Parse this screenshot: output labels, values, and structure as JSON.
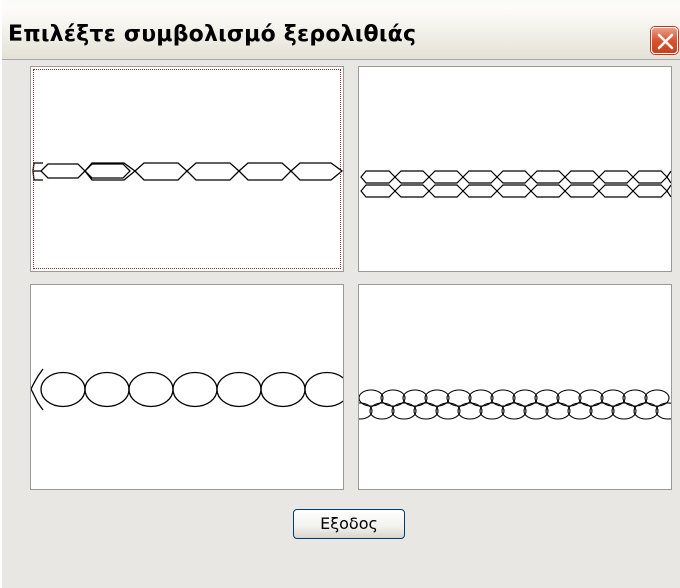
{
  "window": {
    "title": "Επιλέξτε συμβολισμό ξερολιθιάς",
    "close_icon": "close-icon",
    "titlebar_color": "#f6f5ef",
    "close_color": "#d9542f"
  },
  "options": [
    {
      "pattern": "single-row-stones",
      "selected": true
    },
    {
      "pattern": "double-row-stones",
      "selected": false
    },
    {
      "pattern": "single-row-round-stones",
      "selected": false
    },
    {
      "pattern": "double-row-round-stones",
      "selected": false
    }
  ],
  "footer": {
    "exit_label": "Εξοδος"
  }
}
